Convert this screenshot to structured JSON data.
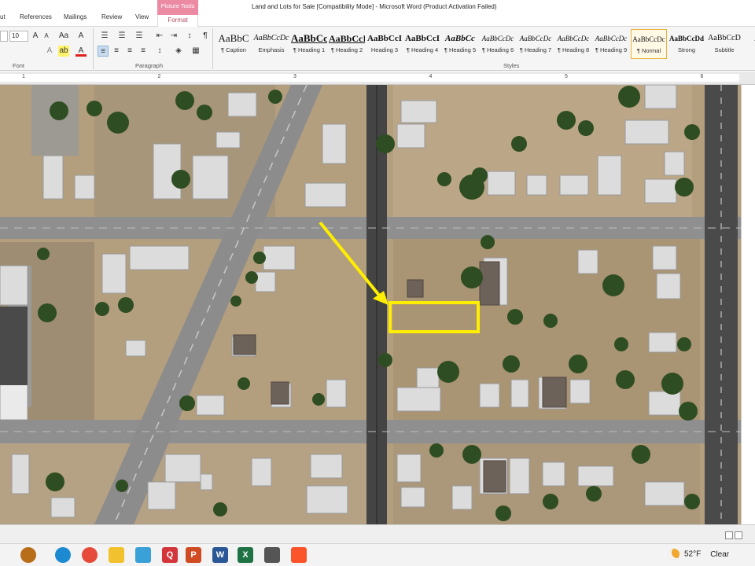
{
  "window": {
    "title": "Land and Lots for Sale [Compatibility Mode]  -  Microsoft Word (Product Activation Failed)"
  },
  "tabs": [
    "ut",
    "References",
    "Mailings",
    "Review",
    "View"
  ],
  "contextual": {
    "label": "Picture Tools",
    "tab": "Format",
    "color": "#ec8aa3"
  },
  "ribbon": {
    "font_group_label": "Font",
    "paragraph_group_label": "Paragraph",
    "styles_group_label": "Styles",
    "font_size": "10",
    "styles": [
      {
        "sample": "AaBbC",
        "name": "¶ Caption"
      },
      {
        "sample": "AaBbCcDc",
        "name": "Emphasis"
      },
      {
        "sample": "AaBbCc",
        "name": "¶ Heading 1"
      },
      {
        "sample": "AaBbCcI",
        "name": "¶ Heading 2"
      },
      {
        "sample": "AaBbCcI",
        "name": "Heading 3"
      },
      {
        "sample": "AaBbCcI",
        "name": "¶ Heading 4"
      },
      {
        "sample": "AaBbCc",
        "name": "¶ Heading 5"
      },
      {
        "sample": "AaBbCcDc",
        "name": "¶ Heading 6"
      },
      {
        "sample": "AaBbCcDc",
        "name": "¶ Heading 7"
      },
      {
        "sample": "AaBbCcDc",
        "name": "¶ Heading 8"
      },
      {
        "sample": "AaBbCcDc",
        "name": "¶ Heading 9"
      },
      {
        "sample": "AaBbCcDc",
        "name": "¶ Normal",
        "selected": true
      },
      {
        "sample": "AaBbCcDd",
        "name": "Strong"
      },
      {
        "sample": "AaBbCcD",
        "name": "Subtitle"
      },
      {
        "sample": "AaB",
        "name": ""
      }
    ]
  },
  "ruler": {
    "numbers": [
      "1",
      "2",
      "3",
      "4",
      "5",
      "6"
    ]
  },
  "map": {
    "description_hidden": "",
    "highlight_color": "#ffee00"
  },
  "taskbar": {
    "apps": [
      {
        "icon": "edge-icon",
        "color": "#1c8ad1"
      },
      {
        "icon": "chrome-icon",
        "color": "#e64a3b"
      },
      {
        "icon": "file-explorer-icon",
        "color": "#f2c12e"
      },
      {
        "icon": "photos-icon",
        "color": "#3aa0d8"
      },
      {
        "icon": "quickbooks-icon",
        "color": "#d3353a"
      },
      {
        "icon": "powerpoint-icon",
        "color": "#d04a22"
      },
      {
        "icon": "word-icon",
        "color": "#2b5797"
      },
      {
        "icon": "excel-icon",
        "color": "#1f7244"
      },
      {
        "icon": "app-icon",
        "color": "#555555"
      },
      {
        "icon": "brave-icon",
        "color": "#fb542b"
      }
    ],
    "app_letters": [
      "",
      "",
      "",
      "",
      "Q",
      "P",
      "W",
      "X",
      "",
      ""
    ],
    "temperature": "52°F",
    "condition": "Clear"
  }
}
